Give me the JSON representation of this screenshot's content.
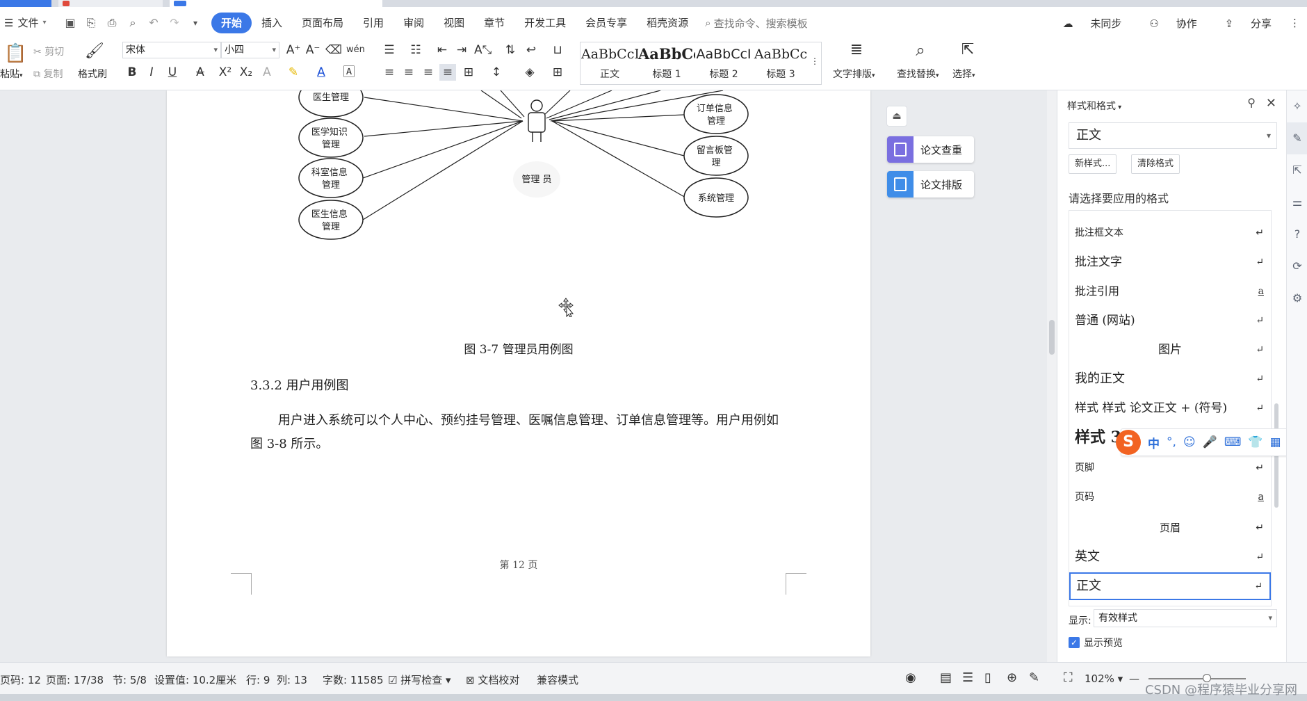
{
  "menubar": {
    "file": "文件",
    "tabs": [
      "开始",
      "插入",
      "页面布局",
      "引用",
      "审阅",
      "视图",
      "章节",
      "开发工具",
      "会员专享",
      "稻壳资源"
    ],
    "active_tab": "开始",
    "search_placeholder": "查找命令、搜索模板",
    "right": [
      "未同步",
      "协作",
      "分享"
    ]
  },
  "ribbon": {
    "paste": "粘贴",
    "cut": "剪切",
    "copy": "复制",
    "format_painter": "格式刷",
    "font_name": "宋体",
    "font_size": "小四",
    "styles": [
      {
        "preview": "AaBbCcI",
        "name": "正文"
      },
      {
        "preview": "AaBbCcI",
        "name": "标题 1"
      },
      {
        "preview": "AaBbCcI",
        "name": "标题 2"
      },
      {
        "preview": "AaBbCc",
        "name": "标题 3"
      }
    ],
    "text_layout": "文字排版",
    "find_replace": "查找替换",
    "select": "选择"
  },
  "document": {
    "diagram": {
      "actor_label": "管理 员",
      "left_cases": [
        "医生管理",
        "医学知识管理",
        "科室信息管理",
        "医生信息管理"
      ],
      "right_cases": [
        "订单信息管理",
        "留言板管理",
        "系统管理"
      ]
    },
    "caption": "图 3-7  管理员用例图",
    "heading": "3.3.2 用户用例图",
    "paragraph": "用户进入系统可以个人中心、预约挂号管理、医嘱信息管理、订单信息管理等。用户用例如图 3-8 所示。",
    "page_number": "第  12  页"
  },
  "tools": {
    "plagiarism_check": "论文查重",
    "paper_layout": "论文排版"
  },
  "styles_panel": {
    "title": "样式和格式",
    "current": "正文",
    "new_style": "新样式...",
    "clear_format": "清除格式",
    "prompt": "请选择要应用的格式",
    "items": [
      {
        "name": "批注框文本",
        "mark": "↵"
      },
      {
        "name": "批注文字",
        "mark": "↵"
      },
      {
        "name": "批注引用",
        "mark": "a"
      },
      {
        "name": "普通 (网站)",
        "mark": "↵"
      },
      {
        "name": "图片",
        "mark": "↵"
      },
      {
        "name": "我的正文",
        "mark": "↵"
      },
      {
        "name": "样式  样式  论文正文 + (符号)",
        "mark": "↵"
      },
      {
        "name": "样式 3",
        "mark": ""
      },
      {
        "name": "页脚",
        "mark": "↵"
      },
      {
        "name": "页码",
        "mark": "a"
      },
      {
        "name": "页眉",
        "mark": "↵"
      },
      {
        "name": "英文",
        "mark": "↵"
      },
      {
        "name": "正文",
        "mark": "↵"
      }
    ],
    "show_label": "显示:",
    "show_value": "有效样式",
    "show_preview": "显示预览"
  },
  "ime": {
    "items": [
      "中",
      "°,",
      "☺",
      "🎤",
      "⌨"
    ]
  },
  "statusbar": {
    "page_code": "页码: 12",
    "page": "页面: 17/38",
    "section": "节: 5/8",
    "setting": "设置值: 10.2厘米",
    "row": "行: 9",
    "col": "列: 13",
    "words": "字数: 11585",
    "spell_check": "拼写检查",
    "doc_proof": "文档校对",
    "compat_mode": "兼容模式",
    "zoom": "102%"
  },
  "watermark": "CSDN @程序猿毕业分享网",
  "colors": {
    "accent": "#3b78e7",
    "tool_purple": "#7a6fe0",
    "tool_blue": "#3f8de8",
    "ime_orange": "#f26322"
  }
}
